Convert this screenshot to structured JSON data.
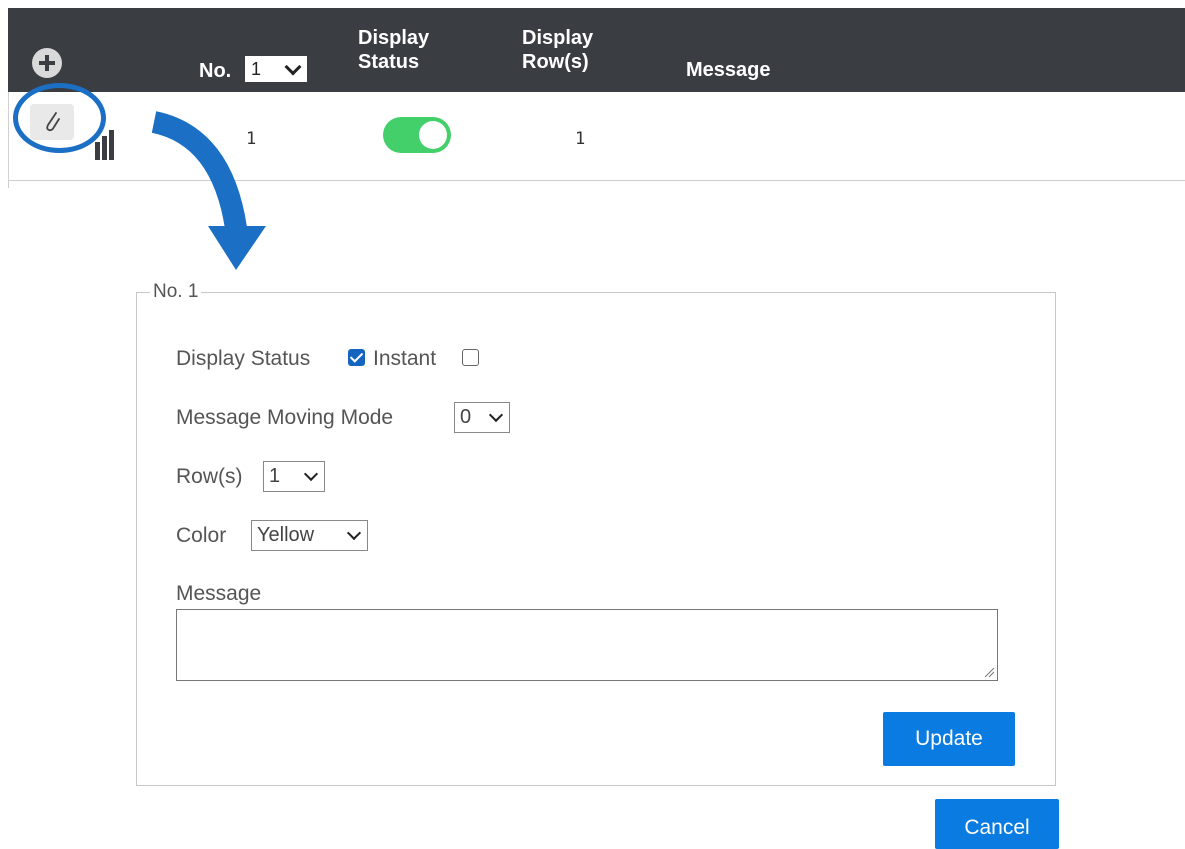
{
  "table": {
    "header": {
      "add_icon": "plus-circle-icon",
      "no_label": "No.",
      "no_selected": "1",
      "display_status_line1": "Display",
      "display_status_line2": "Status",
      "display_rows_line1": "Display",
      "display_rows_line2": "Row(s)",
      "message": "Message"
    },
    "rows": [
      {
        "no": "1",
        "display_status_on": true,
        "display_rows": "1",
        "message": ""
      }
    ]
  },
  "icons": {
    "edit": "pencil-icon",
    "chart": "bar-chart-icon",
    "arrow": "curved-arrow-icon"
  },
  "colors": {
    "header_bg": "#3a3d42",
    "toggle_on": "#43cf6a",
    "accent": "#0a7be0",
    "highlight": "#1b6fc4"
  },
  "edit_form": {
    "legend": "No. 1",
    "display_status_label": "Display Status",
    "display_status_checked": true,
    "instant_label": "Instant",
    "instant_checked": false,
    "moving_mode_label": "Message Moving Mode",
    "moving_mode_value": "0",
    "rows_label": "Row(s)",
    "rows_value": "1",
    "color_label": "Color",
    "color_value": "Yellow",
    "message_label": "Message",
    "message_value": "",
    "update_button": "Update",
    "cancel_button": "Cancel"
  }
}
